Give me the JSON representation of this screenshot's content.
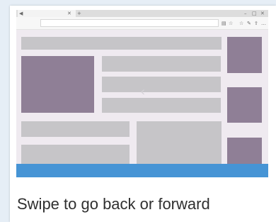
{
  "caption": "Swipe to go back or forward",
  "browser": {
    "icons": {
      "back": "back-arrow-icon",
      "tab_close": "close-icon",
      "new_tab": "plus-icon",
      "minimize": "minimize-icon",
      "maximize": "maximize-icon",
      "close_window": "close-icon",
      "reading_view": "book-icon",
      "favorite": "star-icon",
      "hub": "stars-icon",
      "notes": "pen-icon",
      "share": "share-icon",
      "more": "more-icon"
    }
  },
  "colors": {
    "frame_bg": "#e6eef6",
    "screen_bg": "#efeaf0",
    "placeholder_gray": "#c6c5c8",
    "placeholder_purple": "#8f7f96",
    "accent_blue": "#4694d5",
    "caption_text": "#2f2f2f"
  }
}
